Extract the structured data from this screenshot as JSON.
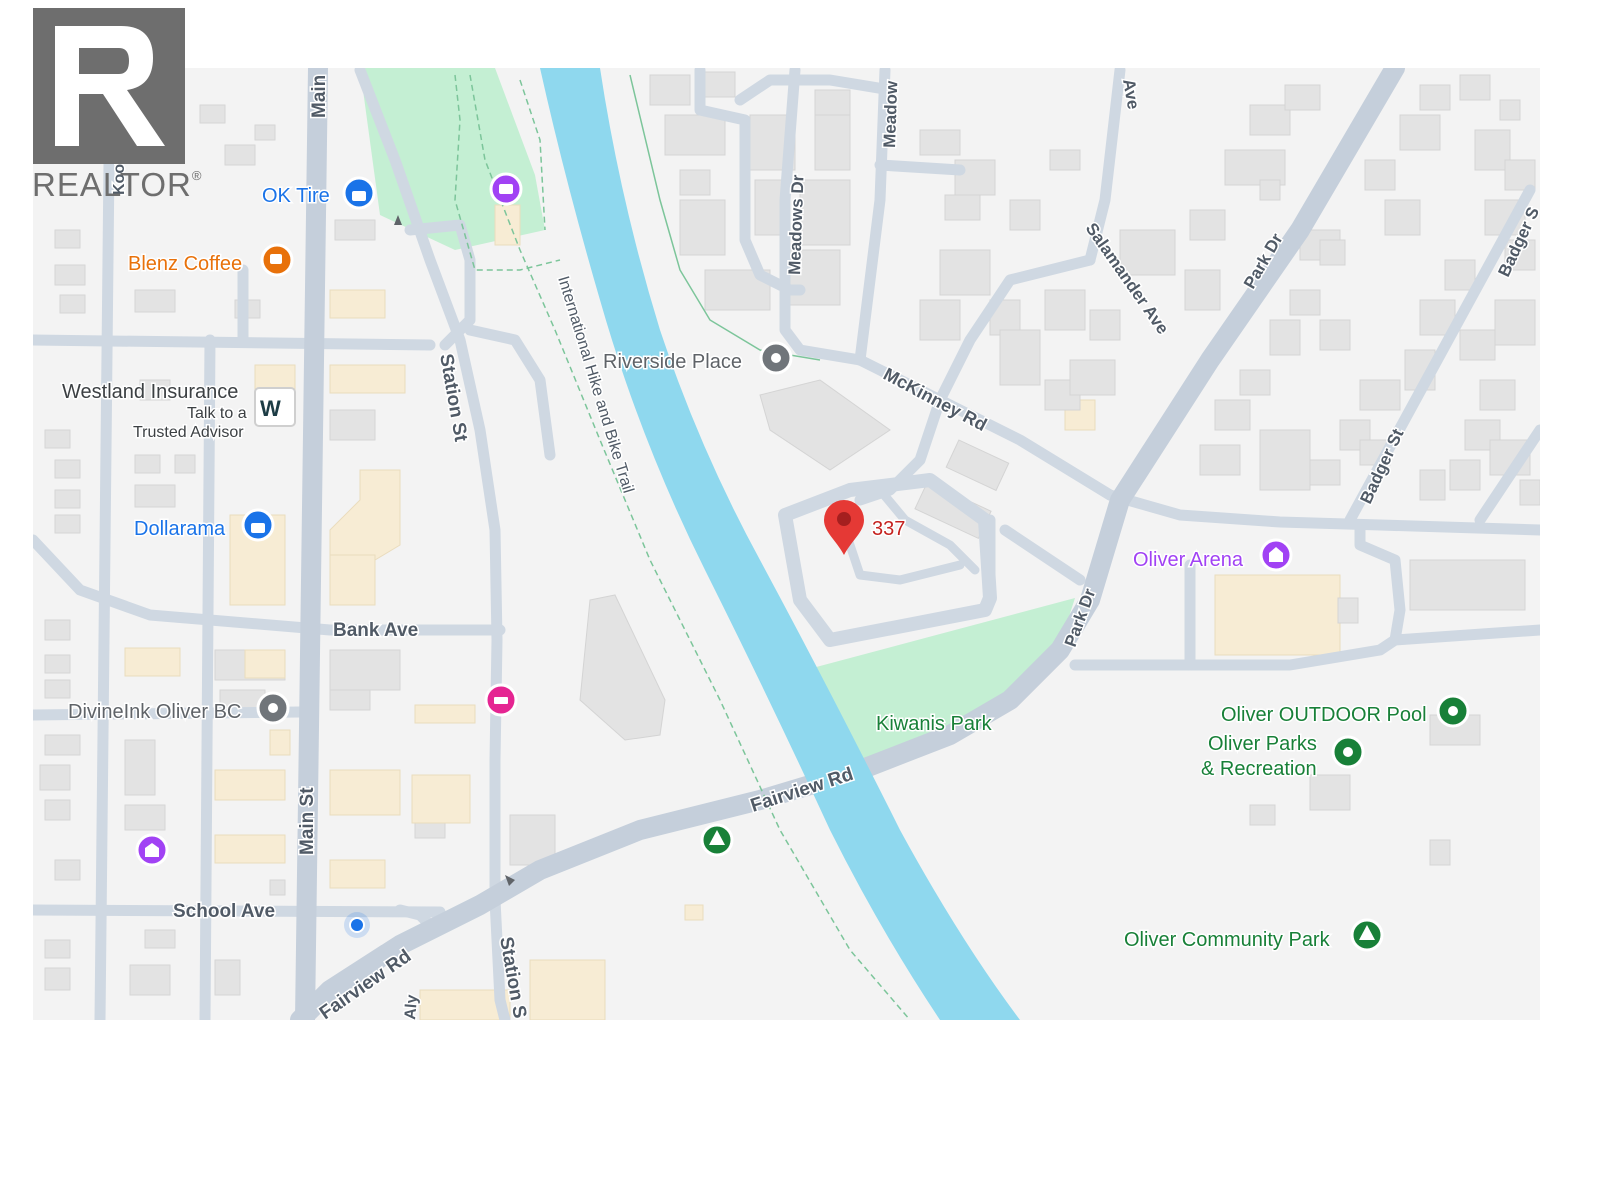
{
  "watermark": {
    "brand": "REALTOR",
    "mark": "®"
  },
  "listing": {
    "number": "337",
    "pin_color": "#e53935"
  },
  "streets": {
    "main_st_top": "Main",
    "main_st": "Main St",
    "kootenay_st": "Kootenay St",
    "station_st": "Station St",
    "station_st_bottom": "Station S",
    "bank_ave": "Bank Ave",
    "school_ave": "School Ave",
    "fairview_rd": "Fairview Rd",
    "fairview_rd_bottom": "Fairview Rd",
    "aly": "Aly",
    "meadows_dr": "Meadows Dr",
    "meadow": "Meadow",
    "salamander_ave": "Salamander Ave",
    "ave_top": "Ave",
    "park_dr_top": "Park Dr",
    "park_dr_mid": "Park Dr",
    "mckinney_rd": "McKinney Rd",
    "badger_st": "Badger St",
    "badger_top": "Badger S",
    "trail": "International Hike and Bike Trail"
  },
  "places": {
    "ok_tire": "OK Tire",
    "blenz_coffee": "Blenz Coffee",
    "westland_insurance": "Westland Insurance",
    "westland_sub1": "Talk to a",
    "westland_sub2": "Trusted Advisor",
    "dollarama": "Dollarama",
    "divineink": "DivineInk Oliver BC",
    "riverside_place": "Riverside Place",
    "oliver_arena": "Oliver Arena",
    "kiwanis_park": "Kiwanis Park",
    "outdoor_pool": "Oliver OUTDOOR Pool",
    "parks_rec_1": "Oliver Parks",
    "parks_rec_2": "& Recreation",
    "community_park": "Oliver Community Park"
  },
  "colors": {
    "land": "#f3f3f3",
    "road": "#cfd8e2",
    "road_edge": "#b9c3cf",
    "river": "#8fd8ee",
    "park": "#c4efd3",
    "building": "#e4e4e4",
    "commercial": "#f7ecd4",
    "blue_poi": "#1a73e8",
    "orange_poi": "#e8710a",
    "purple_poi": "#a142f4",
    "green_poi": "#188038",
    "gray_poi": "#70757a",
    "pink_poi": "#e52592"
  }
}
